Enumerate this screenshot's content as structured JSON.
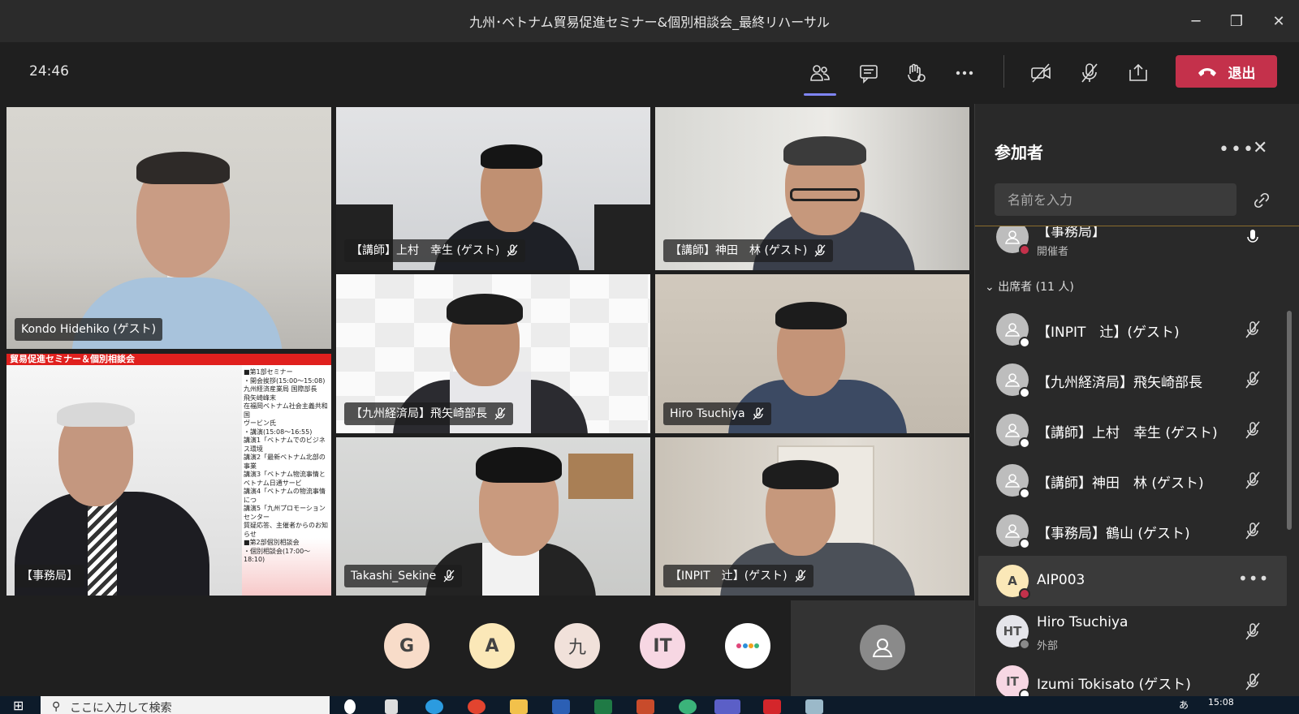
{
  "window": {
    "title": "九州･ベトナム貿易促進セミナー&個別相談会_最終リハーサル",
    "controls": [
      "─",
      "❐",
      "✕"
    ]
  },
  "toolbar": {
    "timer": "24:46",
    "leave_label": "退出",
    "accent_color": "#7f85f5",
    "leave_color": "#c4314b"
  },
  "videos": [
    {
      "label": "Kondo Hidehiko (ゲスト)",
      "muted": false
    },
    {
      "label": "【講師】上村　幸生 (ゲスト)",
      "muted": true
    },
    {
      "label": "【講師】神田　林 (ゲスト)",
      "muted": true
    },
    {
      "label": "【事務局】",
      "muted": false
    },
    {
      "label": "【九州経済局】飛矢崎部長",
      "muted": true
    },
    {
      "label": "Hiro Tsuchiya",
      "muted": true
    },
    {
      "label": "Takashi_Sekine",
      "muted": true
    },
    {
      "label": "【INPIT　辻】(ゲスト)",
      "muted": true
    }
  ],
  "slide": {
    "header": "貿易促進セミナー＆個別相談会",
    "lines": [
      "■第1部セミナー",
      "・開会挨拶(15:00〜15:08)",
      "九州経済産業局 国際部長",
      "飛矢崎峰末",
      "在福岡ベトナム社会主義共和国",
      "ヴービン氏",
      "・講演(15:08〜16:55)",
      "講演1「ベトナムでのビジネス環境",
      "講演2「最新ベトナム北部の事業",
      "講演3「ベトナム物流事情と",
      "ベトナム日通サービ",
      "講演4「ベトナムの物流事情につ",
      "講演5「九州プロモーションセンター",
      "質疑応答、主催者からのお知らせ",
      "■第2部個別相談会",
      "・個別相談会(17:00〜18:10)"
    ]
  },
  "avatar_strip": [
    "G",
    "A",
    "九",
    "IT"
  ],
  "panel": {
    "title": "参加者",
    "search_placeholder": "名前を入力",
    "organizer_name": "【事務局】",
    "organizer_role": "開催者",
    "section_label": "出席者 (11 人)",
    "participants": [
      {
        "initials": "",
        "name": "【INPIT　辻】(ゲスト)",
        "sub": "",
        "status": "white"
      },
      {
        "initials": "",
        "name": "【九州経済局】飛矢崎部長",
        "sub": "",
        "status": "white"
      },
      {
        "initials": "",
        "name": "【講師】上村　幸生 (ゲスト)",
        "sub": "",
        "status": "white"
      },
      {
        "initials": "",
        "name": "【講師】神田　林 (ゲスト)",
        "sub": "",
        "status": "white"
      },
      {
        "initials": "",
        "name": "【事務局】鶴山 (ゲスト)",
        "sub": "",
        "status": "white"
      },
      {
        "initials": "A",
        "name": "AIP003",
        "sub": "",
        "status": "red"
      },
      {
        "initials": "HT",
        "name": "Hiro Tsuchiya",
        "sub": "外部",
        "status": "white"
      },
      {
        "initials": "IT",
        "name": "Izumi Tokisato (ゲスト)",
        "sub": "",
        "status": "white"
      }
    ]
  },
  "taskbar": {
    "search_placeholder": "ここに入力して検索",
    "clock": "15:08",
    "ime": "あ"
  }
}
